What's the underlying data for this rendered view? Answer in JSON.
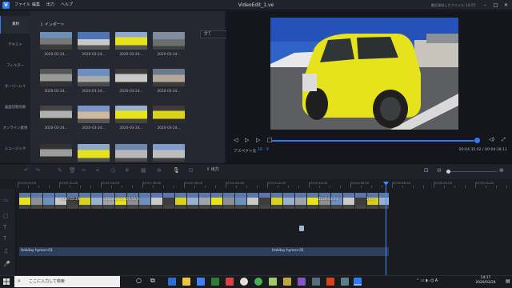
{
  "window": {
    "title": "VideoEdit_1.ve",
    "save_status": "最近保存したファイル 14:15",
    "menu": [
      "ファイル",
      "編集",
      "出力",
      "ヘルプ"
    ]
  },
  "sidebar": {
    "items": [
      {
        "label": "素材",
        "active": true
      },
      {
        "label": "テキスト",
        "active": false
      },
      {
        "label": "フィルター",
        "active": false
      },
      {
        "label": "オーバーレイ",
        "active": false
      },
      {
        "label": "画面切替効果",
        "active": false
      },
      {
        "label": "オンライン素材",
        "active": false
      },
      {
        "label": "ミュージック",
        "active": false
      }
    ]
  },
  "media": {
    "import_label": "インポート",
    "filter_value": "全て",
    "thumbnail_labels": [
      "2020-03-24...",
      "2020-03-24...",
      "2020-03-24...",
      "2020-03-24...",
      "2020-03-24...",
      "2020-03-24...",
      "2020-03-24...",
      "2020-03-24...",
      "2020-03-24...",
      "2020-03-24...",
      "2020-03-24...",
      "2020-03-24..."
    ]
  },
  "preview": {
    "aspect_label": "アスペクト比",
    "aspect_value": "16 : 9",
    "timecode": "00:04:35.02 / 00:04:38.11",
    "progress": 0.985
  },
  "toolbar": {
    "export_label": "出力"
  },
  "timeline": {
    "ruler_labels": [
      "00:00:00.00",
      "00:00:32.00",
      "00:01:04.00",
      "00:01:36.00",
      "00:02:08.00",
      "00:02:40.00",
      "00:03:12.00",
      "00:03:44.00",
      "00:04:16.00",
      "00:04:48.00",
      "00:05:20.00",
      "00:05:52.00"
    ],
    "clip_labels": [
      "2020-03-24",
      "2020-03-24 15.53.0",
      "2020-03-24",
      "2020"
    ],
    "audio_clips": [
      "Holiday hymns-01",
      "Holiday hymns-01"
    ]
  },
  "taskbar": {
    "search_placeholder": "ここに入力して検索",
    "time": "14:17",
    "date": "2020/03/24"
  },
  "colors": {
    "accent": "#2f7df6",
    "background": "#1b1d24",
    "car_yellow": "#e6e21c"
  }
}
